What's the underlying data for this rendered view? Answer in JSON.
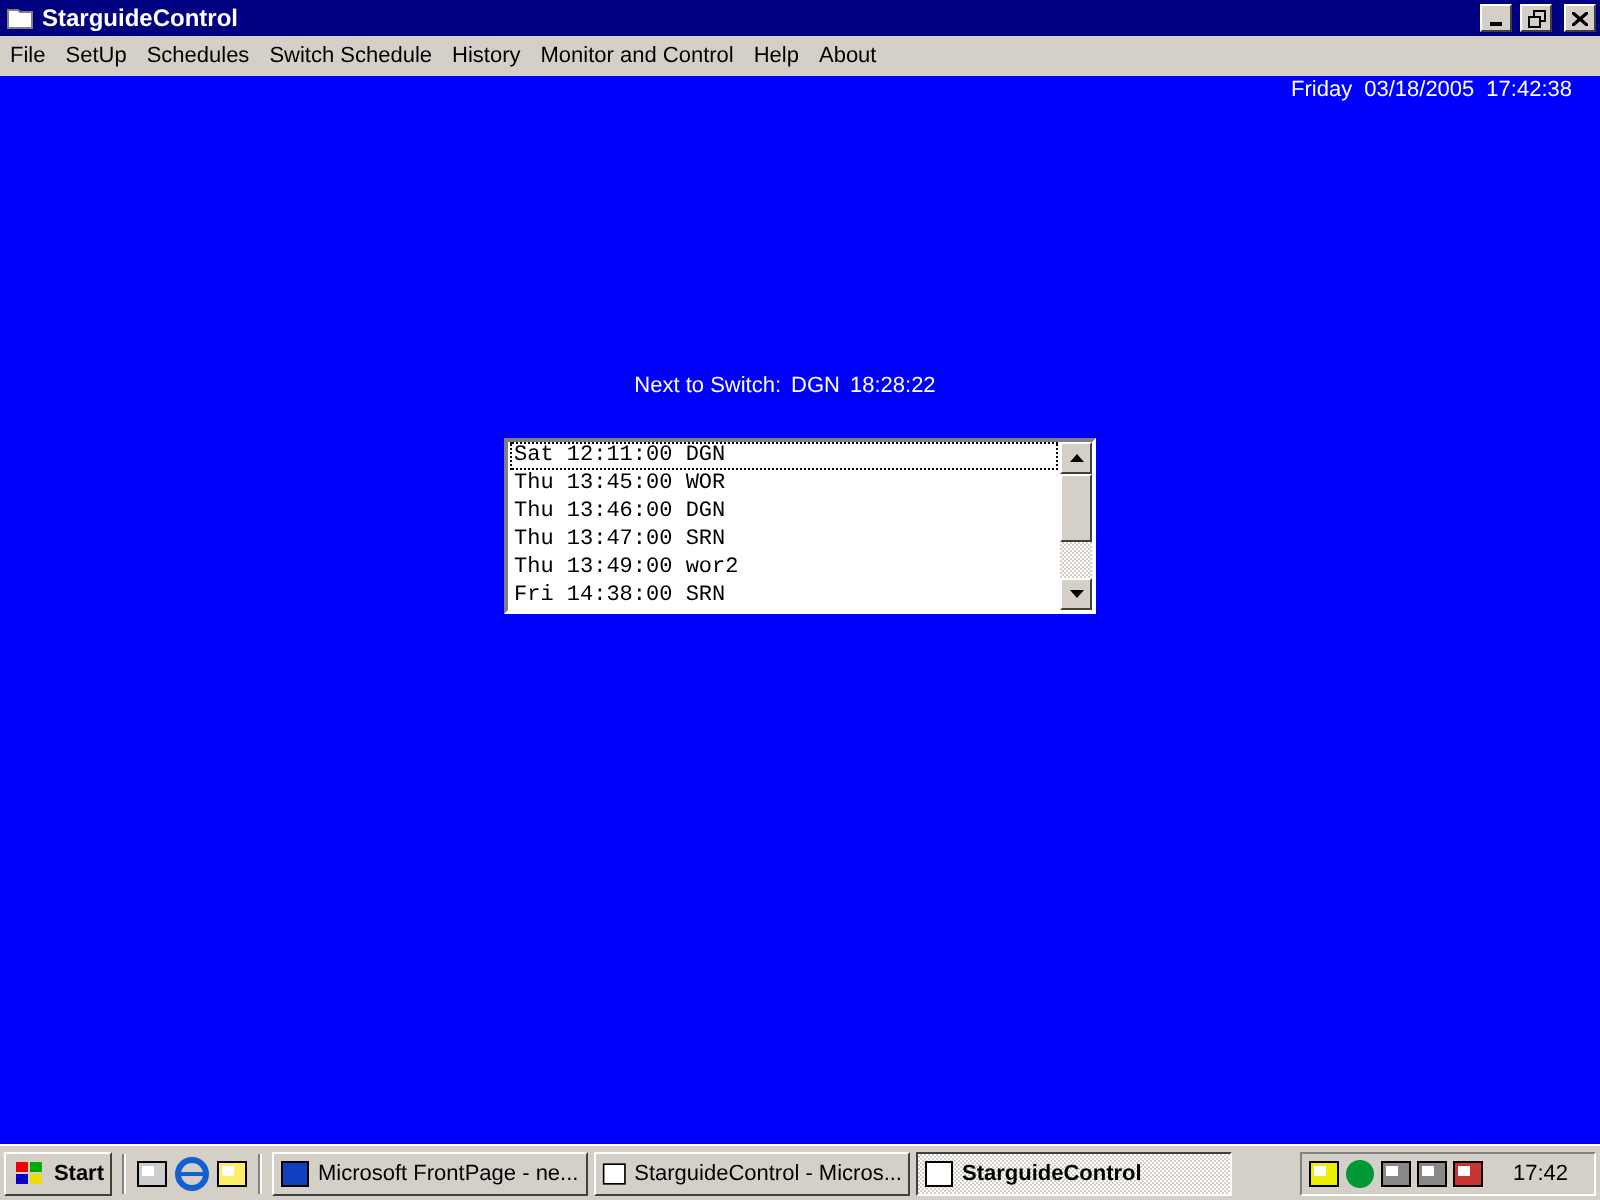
{
  "window": {
    "title": "StarguideControl"
  },
  "menu": [
    "File",
    "SetUp",
    "Schedules",
    "Switch Schedule",
    "History",
    "Monitor and Control",
    "Help",
    "About"
  ],
  "datetime": {
    "day": "Friday",
    "date": "03/18/2005",
    "time": "17:42:38"
  },
  "next_to_switch": {
    "label": "Next to Switch:",
    "station": "DGN",
    "time": "18:28:22"
  },
  "schedule": [
    {
      "text": "Sat 12:11:00 DGN",
      "selected": true
    },
    {
      "text": "Thu 13:45:00 WOR",
      "selected": false
    },
    {
      "text": "Thu 13:46:00 DGN",
      "selected": false
    },
    {
      "text": "Thu 13:47:00 SRN",
      "selected": false
    },
    {
      "text": "Thu 13:49:00 wor2",
      "selected": false
    },
    {
      "text": "Fri 14:38:00 SRN",
      "selected": false
    }
  ],
  "taskbar": {
    "start": "Start",
    "tasks": [
      {
        "label": "Microsoft FrontPage - ne...",
        "selected": false
      },
      {
        "label": "StarguideControl - Micros...",
        "selected": false
      },
      {
        "label": "StarguideControl",
        "selected": true
      }
    ],
    "clock": "17:42"
  }
}
